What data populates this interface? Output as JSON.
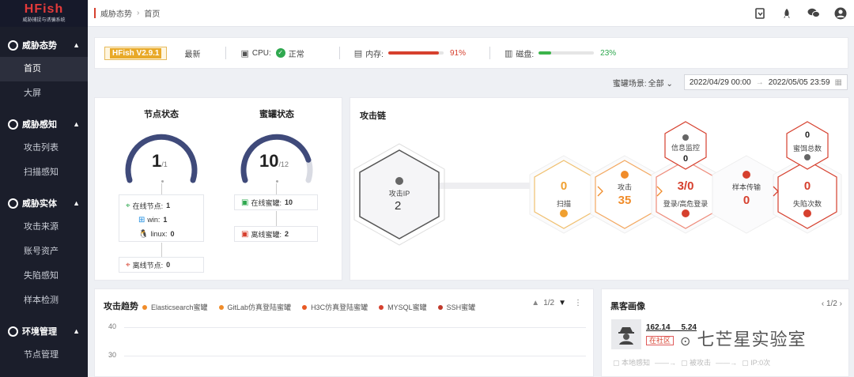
{
  "sidebar": {
    "logo_title": "HFish",
    "logo_sub": "威胁捕捉与诱骗系统",
    "groups": [
      {
        "label": "威胁态势",
        "items": [
          {
            "label": "首页"
          },
          {
            "label": "大屏"
          }
        ]
      },
      {
        "label": "威胁感知",
        "items": [
          {
            "label": "攻击列表"
          },
          {
            "label": "扫描感知"
          }
        ]
      },
      {
        "label": "威胁实体",
        "items": [
          {
            "label": "攻击来源"
          },
          {
            "label": "账号资产"
          },
          {
            "label": "失陷感知"
          },
          {
            "label": "样本检测"
          }
        ]
      },
      {
        "label": "环境管理",
        "items": [
          {
            "label": "节点管理"
          }
        ]
      }
    ]
  },
  "breadcrumb": {
    "parent": "威胁态势",
    "current": "首页"
  },
  "version": {
    "badge": "HFish V2.9.1",
    "latest": "最新",
    "cpu_label": "CPU:",
    "cpu_status": "正常",
    "mem_label": "内存:",
    "mem_pct": "91%",
    "mem_fraction": 0.91,
    "disk_label": "磁盘:",
    "disk_pct": "23%",
    "disk_fraction": 0.23
  },
  "scene": {
    "label": "蜜罐场景:",
    "value": "全部",
    "date_from": "2022/04/29 00:00",
    "date_to": "2022/05/05 23:59"
  },
  "node_status": {
    "title": "节点状态",
    "online": 1,
    "total_label": "/1",
    "online_label": "在线节点:",
    "online_val": "1",
    "win_label": "win:",
    "win_val": "1",
    "linux_label": "linux:",
    "linux_val": "0",
    "offline_label": "离线节点:",
    "offline_val": "0"
  },
  "honeypot_status": {
    "title": "蜜罐状态",
    "online": 10,
    "total_label": "/12",
    "online_label": "在线蜜罐:",
    "online_val": "10",
    "offline_label": "离线蜜罐:",
    "offline_val": "2"
  },
  "attack_chain": {
    "title": "攻击链",
    "ip_label": "攻击IP",
    "ip_val": "2",
    "scan_val": "0",
    "scan_label": "扫描",
    "attack_val": "35",
    "attack_label": "攻击",
    "login_val": "3/0",
    "login_label": "登录/高危登录",
    "sample_label": "样本传输",
    "sample_val": "0",
    "fall_val": "0",
    "fall_label": "失陷次数",
    "intel_label": "信息监控",
    "intel_val": "0",
    "bait_val": "0",
    "bait_label": "蜜饵总数"
  },
  "trend": {
    "title": "攻击趋势",
    "legend": [
      {
        "name": "Elasticsearch蜜罐",
        "color": "#f08c2a"
      },
      {
        "name": "GitLab仿真登陆蜜罐",
        "color": "#f08c2a"
      },
      {
        "name": "H3C仿真登陆蜜罐",
        "color": "#e85a24"
      },
      {
        "name": "MYSQL蜜罐",
        "color": "#d6402e"
      },
      {
        "name": "SSH蜜罐",
        "color": "#c0392b"
      }
    ],
    "page": "1/2",
    "y_ticks": [
      "40",
      "30"
    ]
  },
  "hacker": {
    "title": "黑客画像",
    "page": "1/2",
    "ip": "162.14",
    "ip_tail": "5.24",
    "tag": "在社区",
    "flow": [
      "本地感知",
      "被攻击",
      "IP:0次"
    ]
  },
  "watermark": "七芒星实验室"
}
